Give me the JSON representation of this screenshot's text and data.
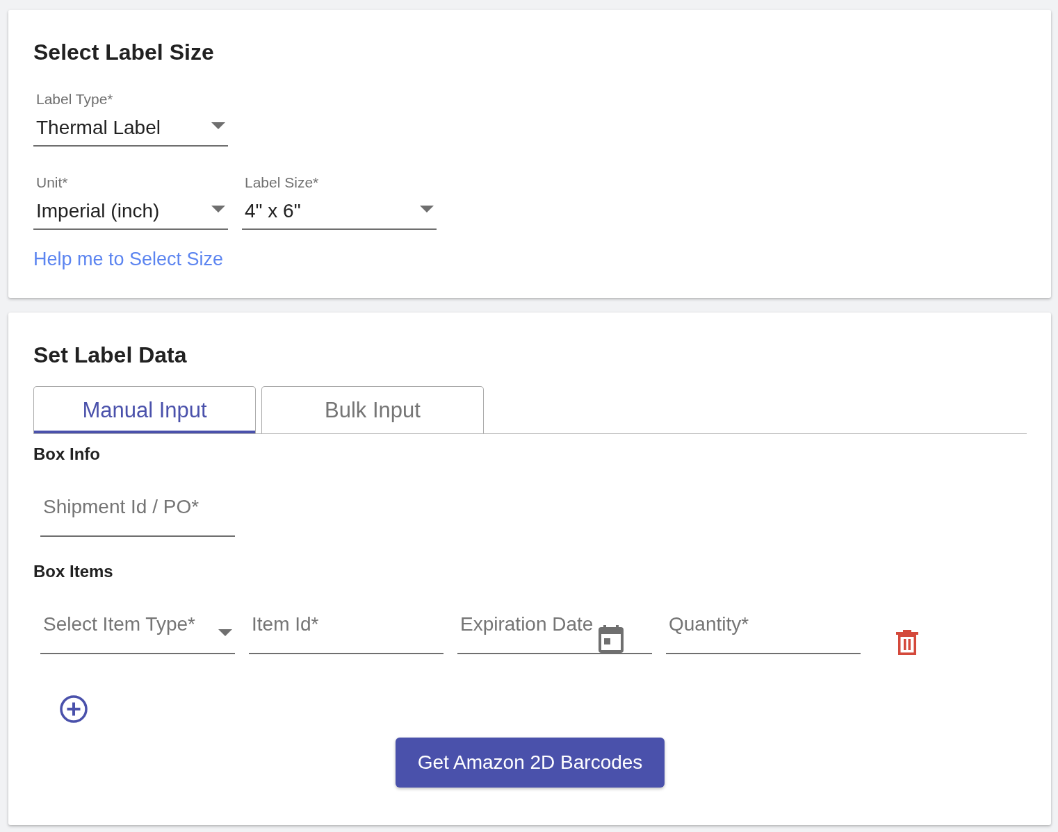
{
  "label_size_card": {
    "title": "Select Label Size",
    "label_type": {
      "label": "Label Type*",
      "value": "Thermal Label"
    },
    "unit": {
      "label": "Unit*",
      "value": "Imperial (inch)"
    },
    "label_size": {
      "label": "Label Size*",
      "value": "4\" x 6\""
    },
    "help_link": "Help me to Select Size"
  },
  "label_data_card": {
    "title": "Set Label Data",
    "tabs": [
      {
        "label": "Manual Input",
        "selected": true
      },
      {
        "label": "Bulk Input",
        "selected": false
      }
    ],
    "box_info": {
      "heading": "Box Info",
      "shipment_id": {
        "placeholder": "Shipment Id / PO*"
      }
    },
    "box_items": {
      "heading": "Box Items",
      "rows": [
        {
          "item_type": {
            "placeholder": "Select Item Type*"
          },
          "item_id": {
            "placeholder": "Item Id*"
          },
          "expiration_date": {
            "placeholder": "Expiration Date"
          },
          "quantity": {
            "placeholder": "Quantity*"
          }
        }
      ]
    },
    "submit_button": "Get Amazon 2D Barcodes"
  }
}
